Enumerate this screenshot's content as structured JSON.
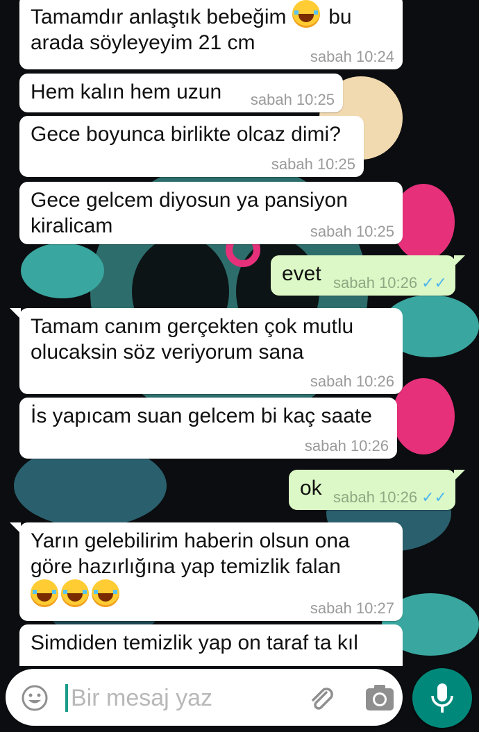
{
  "messages": [
    {
      "dir": "in",
      "lines": [
        "Tamamdır anlaştık bebeğim",
        "arada söyleyeyim 21 cm"
      ],
      "emoji_inline_after": "bu",
      "time": "sabah 10:24"
    },
    {
      "dir": "in",
      "lines": [
        "Hem kalın hem uzun"
      ],
      "time": "sabah 10:25"
    },
    {
      "dir": "in",
      "lines": [
        "Gece boyunca birlikte olcaz dimi?"
      ],
      "time": "sabah 10:25"
    },
    {
      "dir": "in",
      "lines": [
        "Gece gelcem diyosun ya pansiyon",
        "kiralicam"
      ],
      "time": "sabah 10:25"
    },
    {
      "dir": "out",
      "lines": [
        "evet"
      ],
      "time": "sabah 10:26",
      "status": "read"
    },
    {
      "dir": "in",
      "lines": [
        "Tamam canım gerçekten çok mutlu",
        "olucaksin söz veriyorum sana"
      ],
      "time": "sabah 10:26"
    },
    {
      "dir": "in",
      "lines": [
        "İs yapıcam suan gelcem bi kaç saate"
      ],
      "time": "sabah 10:26"
    },
    {
      "dir": "out",
      "lines": [
        "ok"
      ],
      "time": "sabah 10:26",
      "status": "read"
    },
    {
      "dir": "in",
      "lines": [
        "Yarın gelebilirim haberin olsun ona",
        "göre hazırlığına yap temizlik falan"
      ],
      "emoji_count": 3,
      "time": "sabah 10:27"
    },
    {
      "dir": "in",
      "lines": [
        "Simdiden temizlik yap on taraf ta kıl"
      ],
      "time": ""
    }
  ],
  "m0": {
    "line1": "Tamamdır anlaştık bebeğim",
    "after_emoji": "bu",
    "line2": "arada söyleyeyim 21 cm",
    "time": "sabah 10:24"
  },
  "m1": {
    "line1": "Hem kalın hem uzun",
    "time": "sabah 10:25"
  },
  "m2": {
    "line1": "Gece boyunca birlikte olcaz dimi?",
    "time": "sabah 10:25"
  },
  "m3": {
    "line1": "Gece gelcem diyosun ya pansiyon",
    "line2": "kiralicam",
    "time": "sabah 10:25"
  },
  "m4": {
    "line1": "evet",
    "time": "sabah 10:26"
  },
  "m5": {
    "line1": "Tamam canım gerçekten çok mutlu",
    "line2": "olucaksin söz veriyorum sana",
    "time": "sabah 10:26"
  },
  "m6": {
    "line1": "İs yapıcam suan gelcem bi kaç saate",
    "time": "sabah 10:26"
  },
  "m7": {
    "line1": "ok",
    "time": "sabah 10:26"
  },
  "m8": {
    "line1": "Yarın gelebilirim haberin olsun ona",
    "line2": "göre hazırlığına yap temizlik falan",
    "time": "sabah 10:27"
  },
  "m9": {
    "line1": "Simdiden temizlik yap on taraf ta kıl"
  },
  "composer": {
    "placeholder": "Bir mesaj yaz"
  },
  "icons": {
    "emoji": "smiley-icon",
    "attach": "paperclip-icon",
    "camera": "camera-icon",
    "mic": "microphone-icon",
    "read_receipt": "double-check-icon",
    "emoji_glyph": "face-with-tears-of-joy"
  },
  "colors": {
    "incoming_bubble": "#ffffff",
    "outgoing_bubble": "#dcf8c6",
    "mic_button": "#00897b",
    "read_ticks": "#4fb6ec",
    "cursor": "#1a9b8b"
  }
}
